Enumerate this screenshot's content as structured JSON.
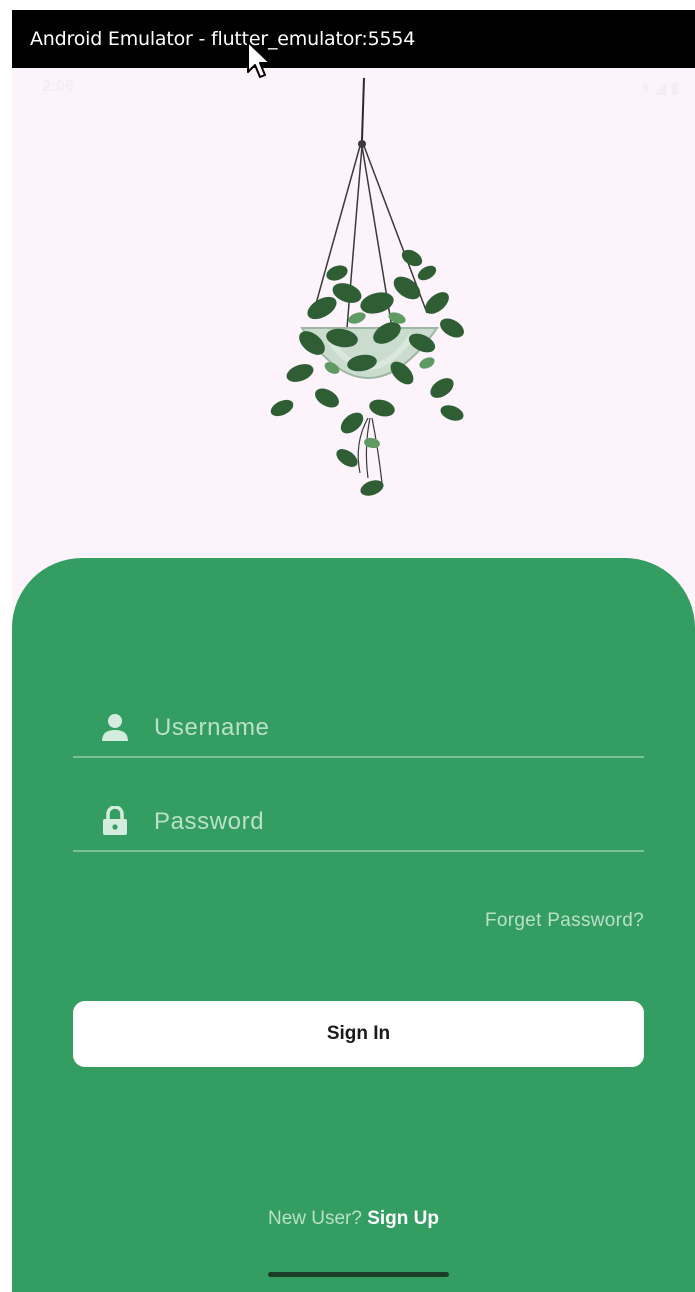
{
  "window": {
    "title": "Android Emulator - flutter_emulator:5554"
  },
  "status_bar": {
    "time": "2:06",
    "icons": [
      "wifi-icon",
      "signal-icon",
      "battery-icon"
    ]
  },
  "login": {
    "username_label": "Username",
    "password_label": "Password",
    "forgot_password": "Forget Password?",
    "sign_in": "Sign In",
    "new_user_prompt": "New User?",
    "sign_up": "Sign Up"
  },
  "colors": {
    "panel": "#349d62",
    "background": "#fcf3fb",
    "button": "#ffffff",
    "hint_text": "#b9e0c8"
  }
}
